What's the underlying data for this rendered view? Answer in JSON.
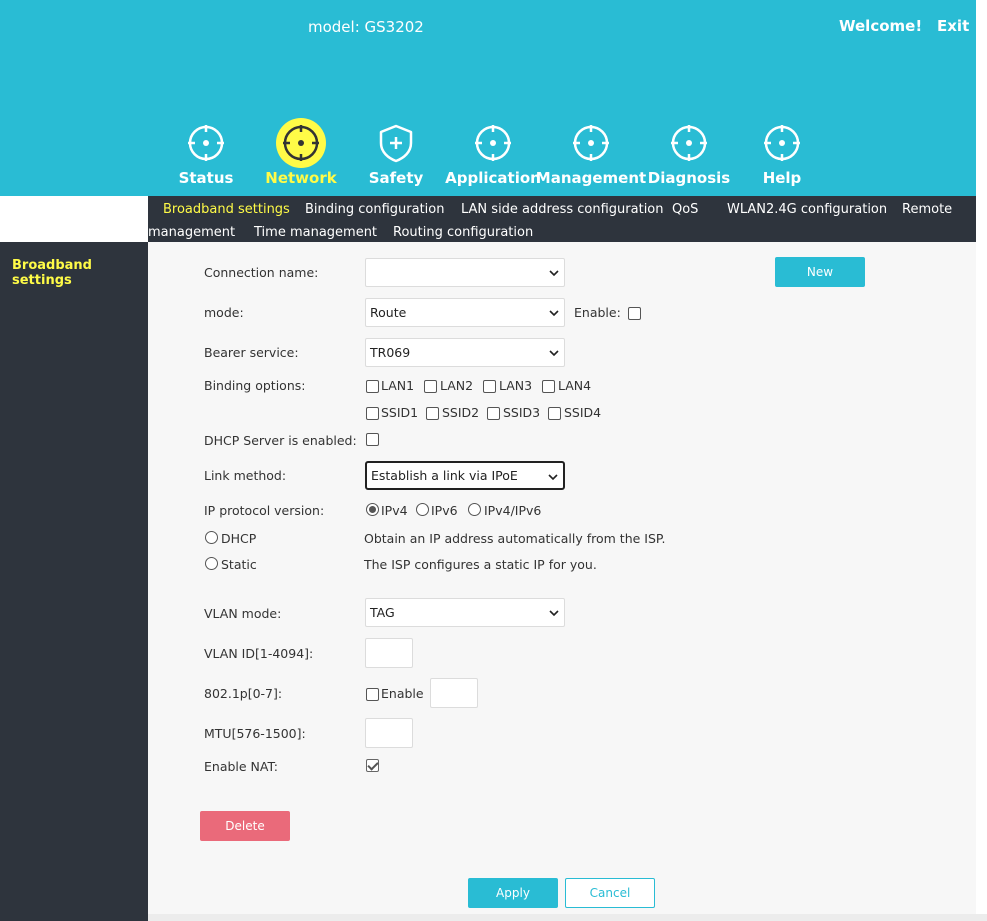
{
  "header": {
    "model": "model: GS3202",
    "welcome": "Welcome!",
    "exit": "Exit"
  },
  "nav": {
    "items": [
      {
        "label": "Status",
        "icon": "target-icon"
      },
      {
        "label": "Network",
        "icon": "target-icon",
        "active": true
      },
      {
        "label": "Safety",
        "icon": "shield-icon"
      },
      {
        "label": "Application",
        "icon": "target-icon"
      },
      {
        "label": "Management",
        "icon": "target-icon"
      },
      {
        "label": "Diagnosis",
        "icon": "target-icon"
      },
      {
        "label": "Help",
        "icon": "target-icon"
      }
    ]
  },
  "subnav": {
    "broadband": "Broadband settings",
    "binding": "Binding configuration",
    "lan": "LAN side address configuration",
    "qos": "QoS",
    "wlan": "WLAN2.4G configuration",
    "remote_a": "Remote",
    "remote_b": "management",
    "time": "Time management",
    "routing": "Routing configuration"
  },
  "sidebar": {
    "item": "Broadband settings"
  },
  "form": {
    "connection_name_label": "Connection name:",
    "connection_name_value": "",
    "new_button": "New",
    "mode_label": "mode:",
    "mode_value": "Route",
    "enable_label": "Enable:",
    "bearer_label": "Bearer service:",
    "bearer_value": "TR069",
    "binding_label": "Binding options:",
    "binding_options": [
      "LAN1",
      "LAN2",
      "LAN3",
      "LAN4",
      "SSID1",
      "SSID2",
      "SSID3",
      "SSID4"
    ],
    "dhcp_server_label": "DHCP Server is enabled:",
    "link_method_label": "Link method:",
    "link_method_value": "Establish a link via IPoE",
    "ip_version_label": "IP protocol version:",
    "ip_versions": [
      "IPv4",
      "IPv6",
      "IPv4/IPv6"
    ],
    "ip_version_selected": "IPv4",
    "dhcp_label": "DHCP",
    "dhcp_desc": "Obtain an IP address automatically from the ISP.",
    "static_label": "Static",
    "static_desc": "The ISP configures a static IP for you.",
    "vlan_mode_label": "VLAN mode:",
    "vlan_mode_value": "TAG",
    "vlan_id_label": "VLAN ID[1-4094]:",
    "vlan_id_value": "",
    "p8021_label": "802.1p[0-7]:",
    "p8021_enable": "Enable",
    "p8021_value": "",
    "mtu_label": "MTU[576-1500]:",
    "mtu_value": "",
    "nat_label": "Enable NAT:",
    "nat_checked": true,
    "delete_button": "Delete",
    "apply_button": "Apply",
    "cancel_button": "Cancel"
  },
  "colors": {
    "header_bg": "#29bcd4",
    "dark_bg": "#2e343d",
    "accent_yellow": "#fffb47",
    "button_cyan": "#29bcd4",
    "button_red": "#ea6a7a"
  }
}
